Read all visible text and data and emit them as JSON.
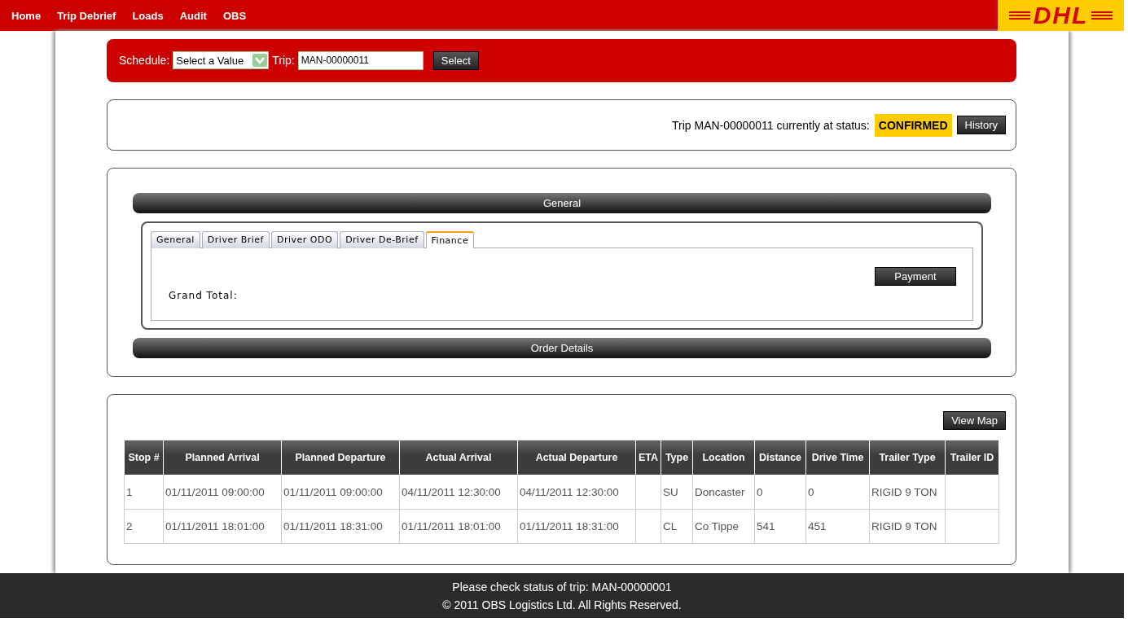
{
  "nav": {
    "items": [
      "Home",
      "Trip Debrief",
      "Loads",
      "Audit",
      "OBS"
    ],
    "logo": "DHL"
  },
  "schedule_bar": {
    "schedule_label": "Schedule:",
    "schedule_value": "Select a Value",
    "trip_label": "Trip:",
    "trip_value": "MAN-00000011",
    "button": "Select"
  },
  "status_panel": {
    "text": "Trip MAN-00000011 currently at status:",
    "status": "CONFIRMED",
    "button": "History"
  },
  "sections": [
    {
      "title": "General",
      "tabs": [
        {
          "label": "General",
          "selected": false
        },
        {
          "label": "Driver Brief",
          "selected": false
        },
        {
          "label": "Driver ODO",
          "selected": false
        },
        {
          "label": "Driver De-Brief",
          "selected": false
        },
        {
          "label": "Finance",
          "selected": true
        }
      ],
      "panel": {
        "grand_total_label": "Grand Total:",
        "button": "Payment"
      }
    },
    {
      "title": "Order Details"
    }
  ],
  "stops": {
    "button": "View Map",
    "columns": [
      "Stop #",
      "Planned Arrival",
      "Planned Departure",
      "Actual Arrival",
      "Actual Departure",
      "ETA",
      "Type",
      "Location",
      "Distance",
      "Drive Time",
      "Trailer Type",
      "Trailer ID"
    ],
    "rows": [
      [
        "1",
        "01/11/2011 09:00:00",
        "01/11/2011 09:00:00",
        "04/11/2011 12:30:00",
        "04/11/2011 12:30:00",
        "",
        "SU",
        "Doncaster",
        "0",
        "0",
        "RIGID 9 TON",
        ""
      ],
      [
        "2",
        "01/11/2011 18:01:00",
        "01/11/2011 18:31:00",
        "01/11/2011 18:01:00",
        "01/11/2011 18:31:00",
        "",
        "CL",
        "Co Tippe",
        "541",
        "451",
        "RIGID 9 TON",
        ""
      ]
    ]
  },
  "footer": {
    "lines": [
      "Please check status of trip: MAN-00000001",
      "© 2011 OBS Logistics Ltd. All Rights Reserved."
    ]
  }
}
